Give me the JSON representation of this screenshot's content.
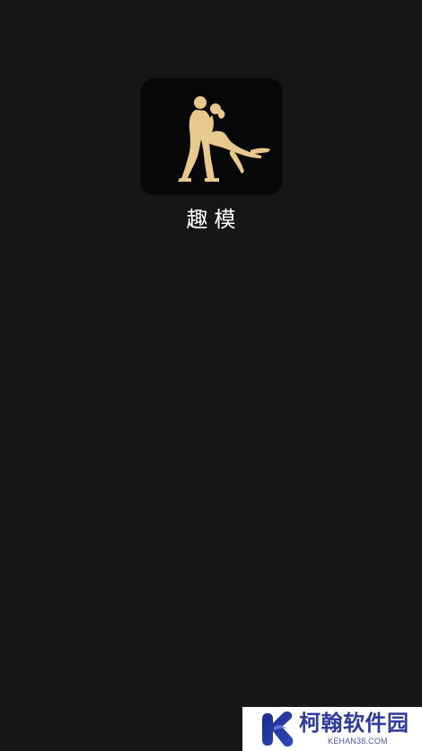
{
  "app": {
    "name": "趣模",
    "icon": "dancing-couple-silhouette-icon"
  },
  "watermark": {
    "brand": "柯翰软件园",
    "domain": "KEHAN38.COM",
    "logo": "k-logo-icon"
  },
  "colors": {
    "background": "#161616",
    "icon_background": "#070707",
    "silhouette_gold": "#e8c98d",
    "app_name_text": "#ffffff",
    "watermark_blue": "#2e3a9d"
  }
}
